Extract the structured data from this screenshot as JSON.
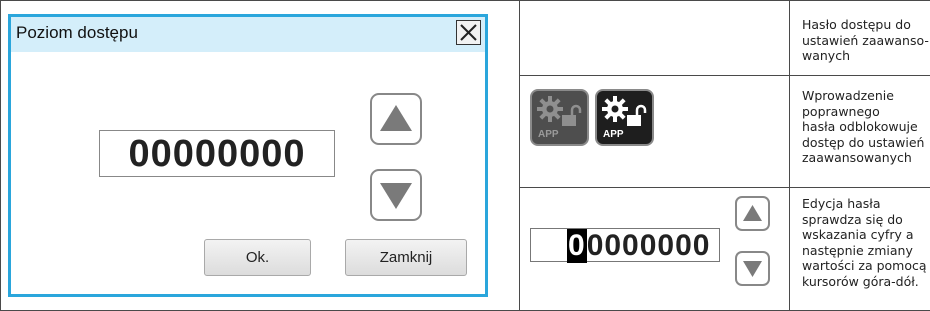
{
  "dialog": {
    "title": "Poziom dostępu",
    "code_value": "00000000",
    "ok_label": "Ok.",
    "close_label": "Zamknij"
  },
  "rows": [
    {
      "description": [
        "Hasło dostępu do",
        "ustawień zaawanso-",
        "wanych"
      ]
    },
    {
      "description": [
        "Wprowadzenie",
        "poprawnego",
        "hasła odblokowuje",
        "dostęp do ustawień",
        "zaawansowanych"
      ],
      "icons": [
        {
          "name": "app-lock-icon-disabled",
          "label": "APP"
        },
        {
          "name": "app-lock-icon-enabled",
          "label": "APP"
        }
      ]
    },
    {
      "description": [
        "Edycja hasła",
        "sprawdza się do",
        "wskazania cyfry a",
        "następnie zmiany",
        "wartości za pomocą",
        "kursorów góra-dół."
      ],
      "code_first_digit": "0",
      "code_rest": "0000000"
    }
  ],
  "colors": {
    "dialog_border": "#2aa6dc",
    "titlebar": "#d4eefa",
    "icon_bg_dim": "#4e4e4e",
    "icon_bg_bright": "#1e1e1e"
  }
}
